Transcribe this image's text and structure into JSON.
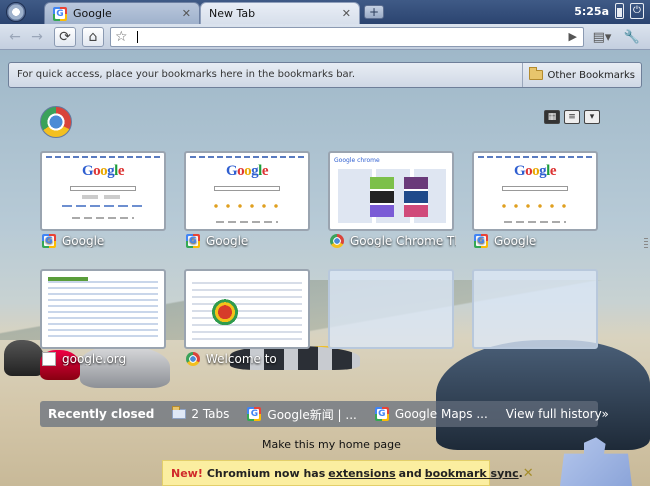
{
  "tabs": [
    {
      "label": "Google",
      "active": false
    },
    {
      "label": "New Tab",
      "active": true
    }
  ],
  "newtab_button": "+",
  "tray": {
    "time": "5:25a"
  },
  "toolbar": {
    "back": "←",
    "forward": "→",
    "reload": "⟳",
    "home": "⌂",
    "star": "☆",
    "go": "▶",
    "page_menu": "▤▾",
    "wrench": "🔧"
  },
  "bookmarks_bar": {
    "hint": "For quick access, place your bookmarks here in the bookmarks bar.",
    "other": "Other Bookmarks"
  },
  "view_controls": [
    "▦",
    "≡",
    "▾"
  ],
  "thumbnails": [
    {
      "title": "Google",
      "kind": "google"
    },
    {
      "title": "Google",
      "kind": "google-cn"
    },
    {
      "title": "Google Chrome The...",
      "kind": "chrome"
    },
    {
      "title": "Google",
      "kind": "google-cn"
    },
    {
      "title": "google.org",
      "kind": "google-org"
    },
    {
      "title": "Welcome to",
      "kind": "welcome"
    },
    {
      "title": "",
      "kind": "empty"
    },
    {
      "title": "",
      "kind": "empty"
    }
  ],
  "recently_closed": {
    "heading": "Recently closed",
    "items": [
      "2 Tabs",
      "Google新闻 | ...",
      "Google Maps ..."
    ],
    "view_all": "View full history»"
  },
  "homepage_link": "Make this my home page",
  "notice": {
    "new_label": "New!",
    "text_before": "Chromium now has",
    "link_extensions": "extensions",
    "text_and": "and",
    "link_sync": "bookmark sync",
    "text_end": ".",
    "close": "✕"
  },
  "colors": {
    "tabstrip": "#3f5a86",
    "notice_bg": "#fbeea0",
    "notice_new": "#d02a2a"
  }
}
